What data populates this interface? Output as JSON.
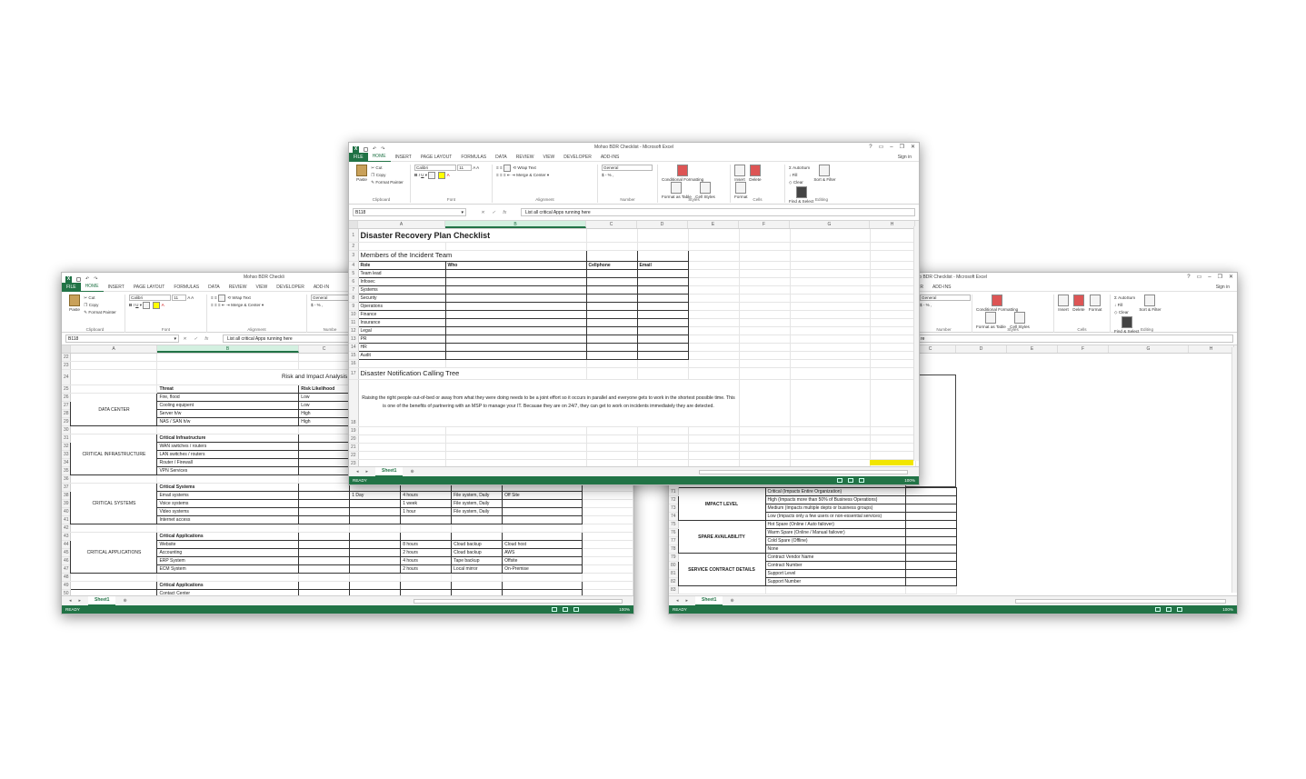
{
  "app_title": "Mohso BDR Checklist - Microsoft Excel",
  "left_title": "Mohso BDR Checkli",
  "right_title": "hso BDR Checklist - Microsoft Excel",
  "window_controls": [
    "?",
    "▭",
    "–",
    "❐",
    "✕"
  ],
  "menu": [
    "INSERT",
    "PAGE LAYOUT",
    "FORMULAS",
    "DATA",
    "REVIEW",
    "VIEW",
    "DEVELOPER",
    "ADD-INS"
  ],
  "menu_file": "FILE",
  "menu_home": "HOME",
  "menu_left_addins": "ADD-IN",
  "right_menu": [
    "ER",
    "ADD-INS"
  ],
  "sign_in": "Sign in",
  "right_sign": "Sign in",
  "ribbon": {
    "paste": "Paste",
    "cut": "Cut",
    "copy": "Copy",
    "format_painter": "Format Painter",
    "clipboard": "Clipboard",
    "font_name": "Calibri",
    "font_size": "11",
    "bold": "B",
    "italic": "I",
    "underline": "U",
    "font": "Font",
    "wrap_text": "Wrap Text",
    "merge_center": "Merge & Center",
    "alignment": "Alignment",
    "number_format": "General",
    "number": "Number",
    "currency": "$ - % ,",
    "conditional_formatting": "Conditional Formatting",
    "format_as_table": "Format as Table",
    "cell_styles": "Cell Styles",
    "styles": "Styles",
    "insert": "Insert",
    "delete": "Delete",
    "format": "Format",
    "cells": "Cells",
    "autosum": "AutoSum",
    "fill": "Fill",
    "clear": "Clear",
    "sort_filter": "Sort & Filter",
    "find_select": "Find & Select",
    "editing": "Editing",
    "left_number": "Numbe"
  },
  "formula": {
    "name_box": "B118",
    "value": "List all critical Apps running here",
    "right_value": "re",
    "fx": "fx",
    "cancel": "✕",
    "enter": "✓"
  },
  "sheet_tab": "Sheet1",
  "add_sheet": "⊕",
  "status": {
    "ready": "READY",
    "zoom": "100%"
  },
  "center_sheet": {
    "columns": [
      "A",
      "B",
      "C",
      "D",
      "E",
      "F",
      "G",
      "H"
    ],
    "title": "Disaster Recovery Plan Checklist",
    "members_title": "Members of the Incident Team",
    "headers": {
      "role": "Role",
      "who": "Who",
      "cellphone": "Cellphone",
      "email": "Email"
    },
    "roles": [
      "Team lead",
      "Infosec",
      "Systems",
      "Security",
      "Operations",
      "Finance",
      "Insurance",
      "Legal",
      "PR",
      "HR",
      "Audit"
    ],
    "calling_tree": "Disaster Notification Calling Tree",
    "paragraph": "Raising the right people out-of-bed or away from what they were doing needs to be a joint effort so it occurs in parallel and everyone gets to work in the shortest possible time. This is one of the benefits of partnering with an MSP to manage your IT. Becauae they are on 24/7, they can get to work on incidents immediately they are detected.",
    "row_numbers": [
      "1",
      "2",
      "3",
      "4",
      "5",
      "6",
      "7",
      "8",
      "9",
      "10",
      "11",
      "12",
      "13",
      "14",
      "15",
      "16",
      "17",
      "18",
      "19",
      "20",
      "21",
      "22",
      "23"
    ]
  },
  "left_sheet": {
    "columns": [
      "A",
      "B",
      "C"
    ],
    "section_title": "Risk and Impact Analysis",
    "headers": {
      "threat": "Threat",
      "likelihood": "Risk Likelihood"
    },
    "groups": [
      {
        "label": "DATA CENTER",
        "rows": [
          {
            "n": "26",
            "item": "Fire, flood",
            "c": "Low"
          },
          {
            "n": "27",
            "item": "Cooling equipent",
            "c": "Low"
          },
          {
            "n": "28",
            "item": "Server h/w",
            "c": "High"
          },
          {
            "n": "29",
            "item": "NAS / SAN h/w",
            "c": "High"
          }
        ]
      },
      {
        "label": "CRITICAL INFRASTRUCTURE",
        "header": "Critical Infrastructure",
        "rows": [
          {
            "n": "32",
            "item": "WAN switches / routers"
          },
          {
            "n": "33",
            "item": "LAN switches / routers"
          },
          {
            "n": "34",
            "item": "Router / Firewall"
          },
          {
            "n": "35",
            "item": "VPN Services"
          }
        ]
      },
      {
        "label": "CRITICAL SYSTEMS",
        "header": "Critical Systems",
        "rows": [
          {
            "n": "38",
            "item": "Email systems",
            "d": "1 Day",
            "e": "4 hours",
            "f": "File system, Daily",
            "g": "Off Site"
          },
          {
            "n": "39",
            "item": "Voice systems",
            "e": "1 week",
            "f": "File system, Daily"
          },
          {
            "n": "40",
            "item": "Video systems",
            "e": "1 hour",
            "f": "File system, Daily"
          },
          {
            "n": "41",
            "item": "Internet access"
          }
        ]
      },
      {
        "label": "CRITICAL APPLICATIONS",
        "header": "Critical Applications",
        "rows": [
          {
            "n": "44",
            "item": "Website",
            "e": "8 hours",
            "f": "Cloud backup",
            "g": "Cloud host"
          },
          {
            "n": "45",
            "item": "Accounting",
            "e": "2 hours",
            "f": "Cloud backup",
            "g": "AWS"
          },
          {
            "n": "46",
            "item": "ERP System",
            "e": "4 hours",
            "f": "Tape backup",
            "g": "Offsite"
          },
          {
            "n": "47",
            "item": "ECM System",
            "e": "2 hours",
            "f": "Local mirror",
            "g": "On-Premise"
          }
        ]
      }
    ],
    "last_header": "Critical Applications",
    "contact_center": "Contact Center",
    "row_nums": {
      "r22": "22",
      "r23": "23",
      "r24": "24",
      "r25": "25",
      "r30": "30",
      "r31": "31",
      "r36": "36",
      "r37": "37",
      "r42": "42",
      "r43": "43",
      "r48": "48",
      "r49": "49",
      "r50": "50"
    }
  },
  "right_sheet": {
    "columns": [
      "C",
      "D",
      "E",
      "F",
      "G",
      "H"
    ],
    "groups": [
      {
        "label": "IMPACT LEVEL",
        "rows": [
          {
            "n": "71",
            "item": "Critical (Impacts Entire Organization)"
          },
          {
            "n": "72",
            "item": "High (Impacts more than 50% of Business Operations)"
          },
          {
            "n": "73",
            "item": "Medium (Impacts multiple depts or business groups)"
          },
          {
            "n": "74",
            "item": "Low (Impacts only a few users or non-essential services)"
          }
        ]
      },
      {
        "label": "SPARE AVAILABILITY",
        "rows": [
          {
            "n": "75",
            "item": "Hot Spare (Online / Auto failover)"
          },
          {
            "n": "76",
            "item": "Warm Spare (Online / Manual failover)"
          },
          {
            "n": "77",
            "item": "Cold Spare (Offline)"
          },
          {
            "n": "78",
            "item": "None"
          }
        ]
      },
      {
        "label": "SERVICE CONTRACT DETAILS",
        "rows": [
          {
            "n": "79",
            "item": "Contract Vendor Name"
          },
          {
            "n": "80",
            "item": "Contract Number"
          },
          {
            "n": "81",
            "item": "Support Level"
          },
          {
            "n": "82",
            "item": "Support Number"
          }
        ]
      }
    ],
    "last_row": "83"
  },
  "colors": {
    "excel_green": "#217346",
    "highlight_yellow": "#f2e600"
  }
}
